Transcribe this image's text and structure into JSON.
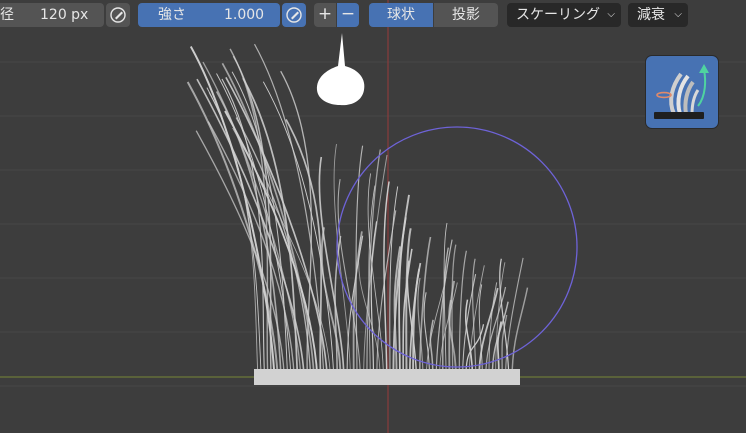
{
  "toolbar": {
    "radius_label_partial": "径",
    "radius_value": "120 px",
    "strength_label": "強さ",
    "strength_value": "1.000",
    "add_label": "+",
    "subtract_label": "−",
    "falloff_shape_sphere": "球状",
    "falloff_shape_projected": "投影",
    "scaling_label": "スケーリング",
    "falloff_label": "減衰"
  },
  "icons": {
    "radius_pen": "pen-pressure-icon",
    "strength_pen": "pen-pressure-icon",
    "dropdown_chevron": "chevron-down-icon",
    "active_tool": "hair-comb-brush-icon"
  },
  "colors": {
    "viewport_bg": "#3d3d3d",
    "active_blue": "#4772b3",
    "field_dark": "#545454",
    "menu_dark": "#282828",
    "brush_circle": "#6e63d8",
    "hair": "#cfcfcf",
    "axis_red": "#8a3d3d",
    "axis_green": "#6b7a3a"
  }
}
